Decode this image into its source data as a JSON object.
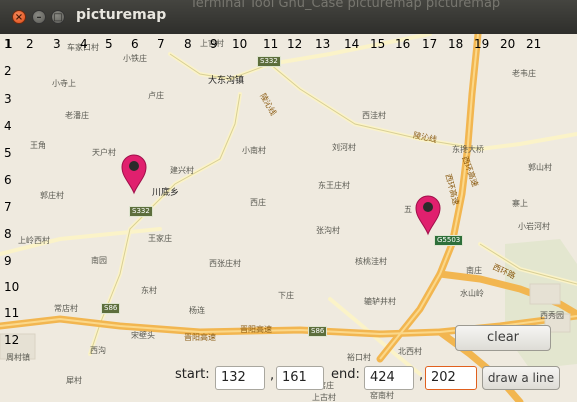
{
  "window": {
    "title": "picturemap",
    "background_title": "Terminal   Tool   Gnu_Case   picturemap   picturemap"
  },
  "axis": {
    "x": [
      "1",
      "2",
      "3",
      "4",
      "5",
      "6",
      "7",
      "8",
      "9",
      "10",
      "11",
      "12",
      "13",
      "14",
      "15",
      "16",
      "17",
      "18",
      "19",
      "20",
      "21"
    ],
    "y": [
      "1",
      "2",
      "3",
      "4",
      "5",
      "6",
      "7",
      "8",
      "9",
      "10",
      "11",
      "12"
    ]
  },
  "map": {
    "places": {
      "p1": "车家口村",
      "p2": "小铁庄",
      "p3": "上官村",
      "p4": "小寺上",
      "p5": "卢庄",
      "p6": "大东沟镇",
      "p7": "老潘庄",
      "p8": "陵沁线",
      "p9": "西洼村",
      "p10": "老韦庄",
      "p11": "天户村",
      "p12": "王角",
      "p13": "小南村",
      "p14": "刘河村",
      "p15": "陵沁线",
      "p16": "东搀大桥",
      "p17": "郭山村",
      "p18": "建兴村",
      "p19": "川底乡",
      "p20": "郭庄村",
      "p21": "东王庄村",
      "p22": "西庄",
      "p23": "西环高速",
      "p24": "寨上",
      "p25": "王家庄",
      "p26": "张沟村",
      "p27": "上岭西村",
      "p28": "小岩河村",
      "p29": "南园",
      "p30": "西张庄村",
      "p31": "核桃洼村",
      "p32": "东村",
      "p33": "下庄",
      "p34": "南庄",
      "p35": "水山岭",
      "p36": "西环路",
      "p37": "杨连",
      "p38": "辘轳井村",
      "p39": "常店村",
      "p40": "宋壁头",
      "p41": "晋阳高速",
      "p42": "晋阳高速",
      "p43": "西秀园",
      "p44": "周村镇",
      "p45": "西沟",
      "p46": "北西村",
      "p47": "裕口村",
      "p48": "犀村",
      "p49": "窑庄",
      "p50": "上古村",
      "p51": "窑南村",
      "p52": "五",
      "p53": "西环高速"
    },
    "shields": {
      "s1": "S332",
      "s2": "S332",
      "s3": "G5503",
      "s4": "S86",
      "s5": "S86"
    }
  },
  "controls": {
    "clear_label": "clear",
    "start_label": "start:",
    "start_x": "132",
    "start_y": "161",
    "comma1": ",",
    "end_label": "end:",
    "end_x": "424",
    "end_y": "202",
    "comma2": ",",
    "draw_label": "draw a line"
  },
  "colors": {
    "marker": "#e0206e",
    "road_major": "#f2b650",
    "road_minor": "#fbf3c8",
    "titlebar": "#3b3b38",
    "focus": "#e0601e"
  }
}
